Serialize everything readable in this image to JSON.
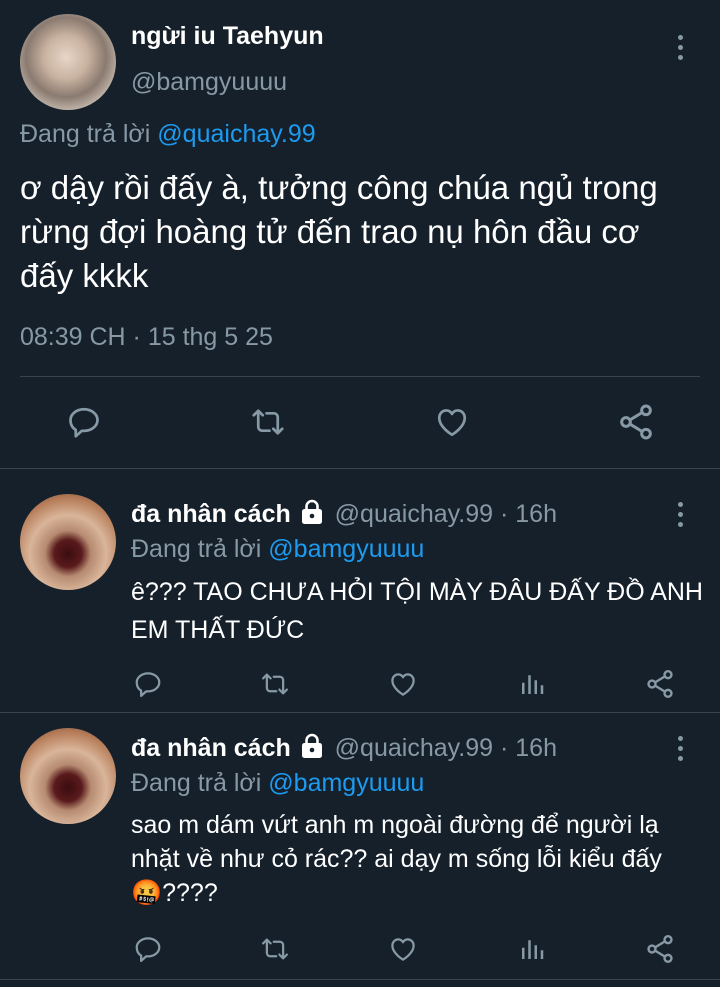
{
  "main_tweet": {
    "display_name": "ngừi iu Taehyun",
    "handle": "@bamgyuuuu",
    "replying_prefix": "Đang trả lời",
    "replying_to": "@quaichay.99",
    "text": "ơ dậy rồi đấy à, tưởng công chúa ngủ trong rừng đợi hoàng tử đến trao nụ hôn đầu cơ đấy kkkk",
    "timestamp": "08:39 CH · 15 thg 5 25"
  },
  "replies": [
    {
      "display_name": "đa nhân cách",
      "handle": "@quaichay.99",
      "time": "· 16h",
      "replying_prefix": "Đang trả lời",
      "replying_to": "@bamgyuuuu",
      "text": "ê??? TAO CHƯA HỎI TỘI MÀY ĐÂU ĐẤY ĐỒ ANH EM THẤT ĐỨC"
    },
    {
      "display_name": "đa nhân cách",
      "handle": "@quaichay.99",
      "time": "· 16h",
      "replying_prefix": "Đang trả lời",
      "replying_to": "@bamgyuuuu",
      "text": "sao m dám vứt anh m ngoài đường để người lạ nhặt về như cỏ rác?? ai dạy m sống lỗi kiểu đấy 🤬????"
    }
  ],
  "icons": {
    "reply": "reply-icon",
    "retweet": "retweet-icon",
    "like": "like-icon",
    "views": "views-icon",
    "share": "share-icon",
    "more": "more-icon",
    "lock": "lock-icon"
  },
  "colors": {
    "background": "#15202b",
    "text": "#ffffff",
    "muted": "#8899a6",
    "link": "#1d9bf0",
    "divider": "#38444d"
  }
}
